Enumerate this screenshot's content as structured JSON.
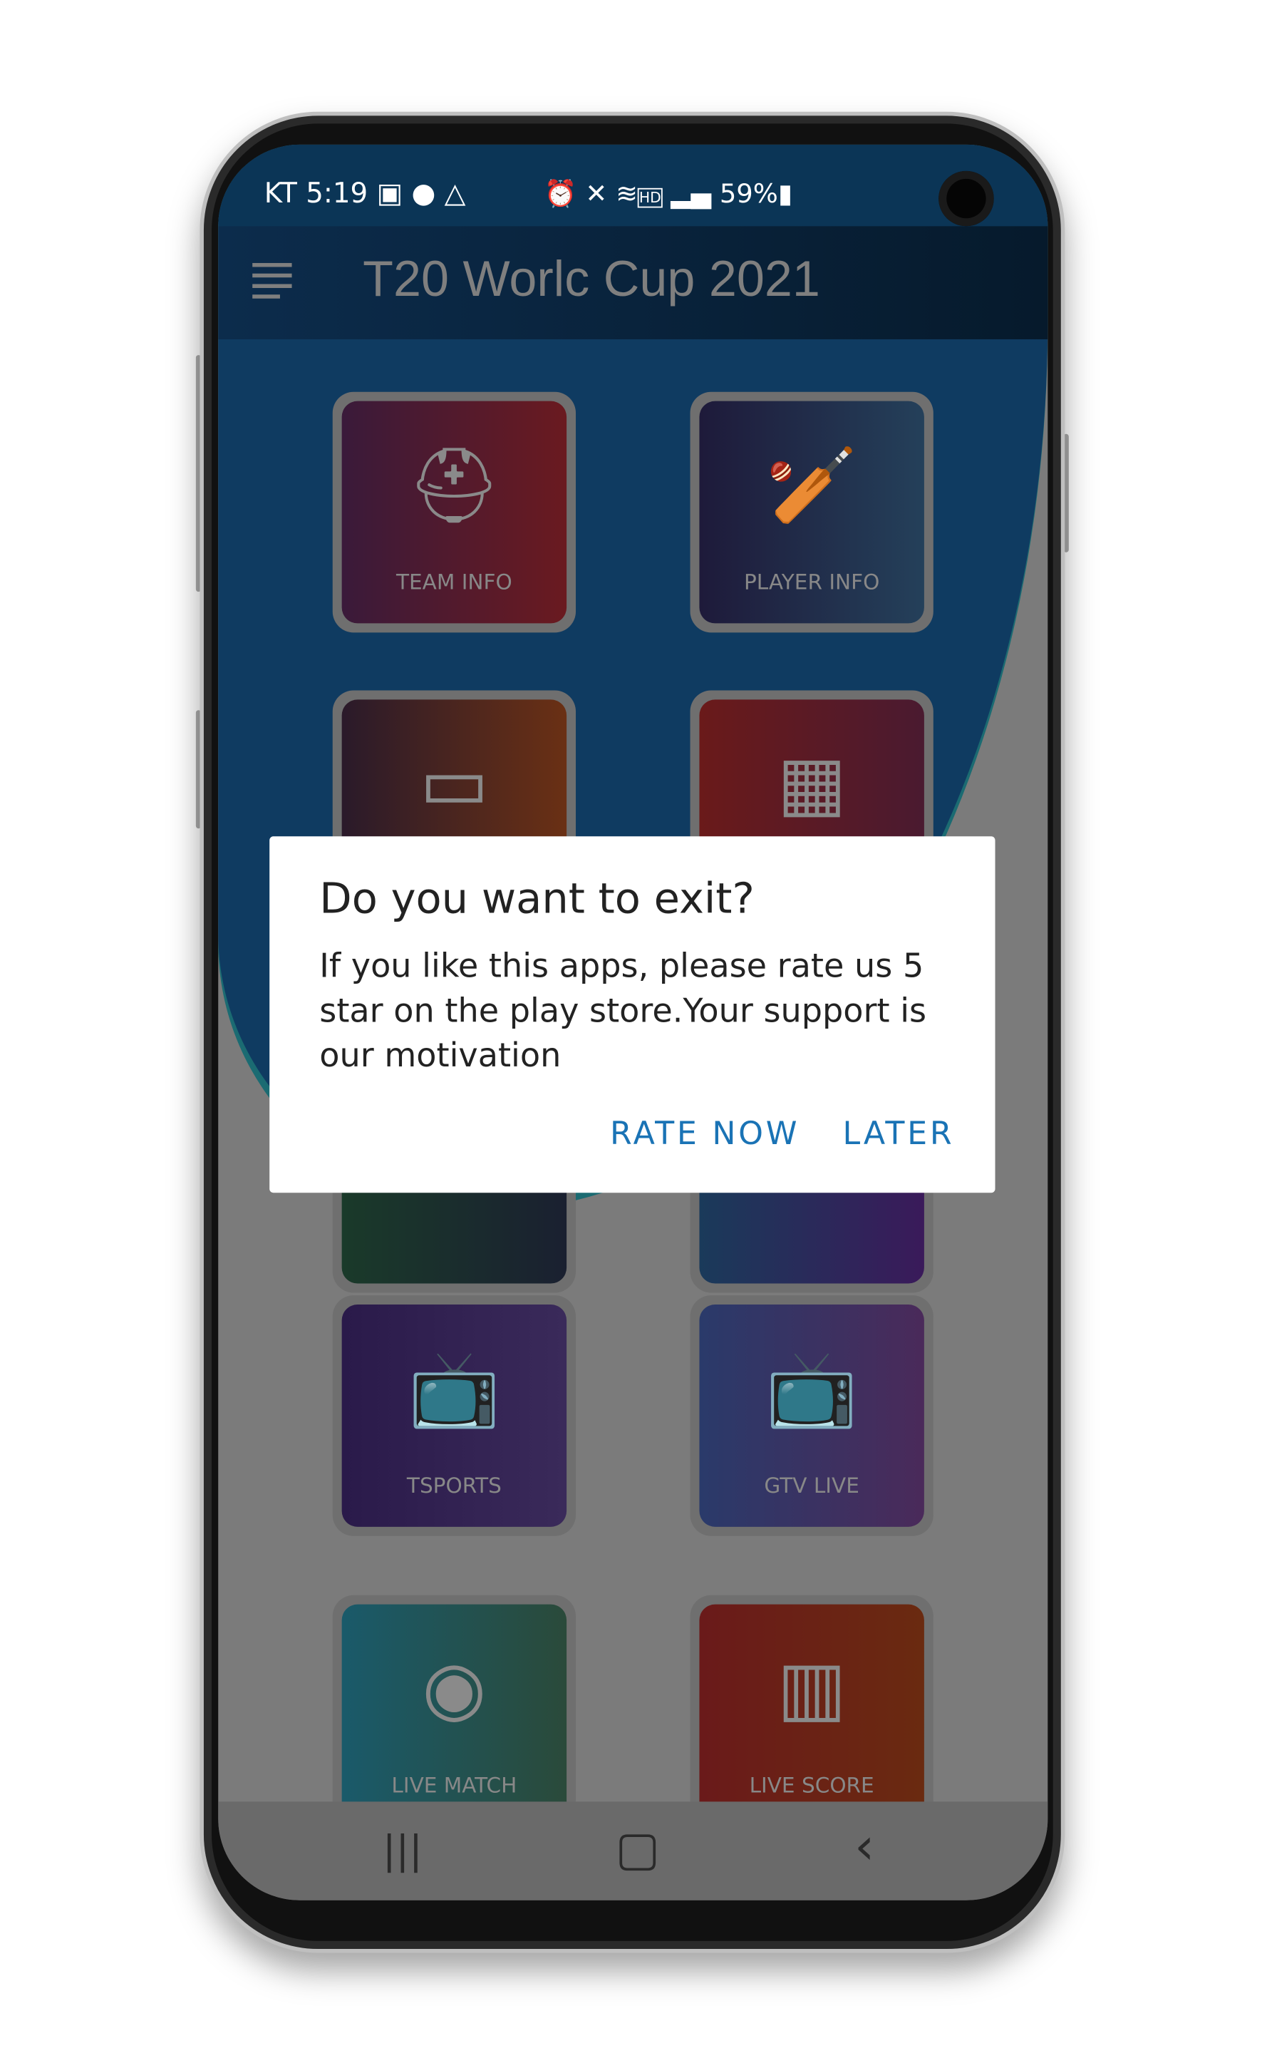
{
  "status_bar": {
    "carrier": "KT",
    "time": "5:19",
    "battery": "59%",
    "left_icons": [
      "image-icon",
      "bulb-icon",
      "drive-icon"
    ],
    "right_icons": [
      "alarm-icon",
      "mute-icon",
      "wifi-icon",
      "hd-icon",
      "signal-icon",
      "battery-icon"
    ]
  },
  "app_bar": {
    "title": "T20 Worlc Cup 2021",
    "menu_icon": "hamburger-icon"
  },
  "tiles": [
    {
      "label": "TEAM INFO",
      "icon": "cricketer-helmet-icon",
      "colors": [
        "#3a1a3a",
        "#6a1a20"
      ]
    },
    {
      "label": "PLAYER INFO",
      "icon": "batsman-icon",
      "colors": [
        "#1e1a3a",
        "#24405a"
      ]
    },
    {
      "label": "",
      "icon": "scoreboard-icon",
      "colors": [
        "#2a1a2a",
        "#6a3014"
      ]
    },
    {
      "label": "",
      "icon": "calendar-icon",
      "colors": [
        "#6a1a1a",
        "#4a1a30"
      ]
    },
    {
      "label": "",
      "icon": "",
      "colors": [
        "#1a3a2a",
        "#1a2030"
      ]
    },
    {
      "label": "",
      "icon": "",
      "colors": [
        "#1a3a5a",
        "#3a1a5a"
      ]
    },
    {
      "label": "TSPORTS",
      "icon": "live-tv-icon",
      "colors": [
        "#2a1a4a",
        "#3a2a5a"
      ]
    },
    {
      "label": "GTV LIVE",
      "icon": "live-tv-icon",
      "colors": [
        "#2a3a6a",
        "#4a2a5a"
      ]
    },
    {
      "label": "LIVE MATCH",
      "icon": "live-broadcast-icon",
      "colors": [
        "#1a5a6a",
        "#2a4a3a"
      ]
    },
    {
      "label": "LIVE SCORE",
      "icon": "cricket-kit-icon",
      "colors": [
        "#6a1a1a",
        "#6a2a10"
      ]
    }
  ],
  "dialog": {
    "title": "Do you want to exit?",
    "message": "If you like this apps, please rate us 5 star on the play store.Your support is our motivation",
    "rate_now": "RATE NOW",
    "later": "LATER",
    "accent": "#1a73b5"
  },
  "nav_bar": {
    "recents": "|||",
    "home": "▢",
    "back": "‹"
  }
}
